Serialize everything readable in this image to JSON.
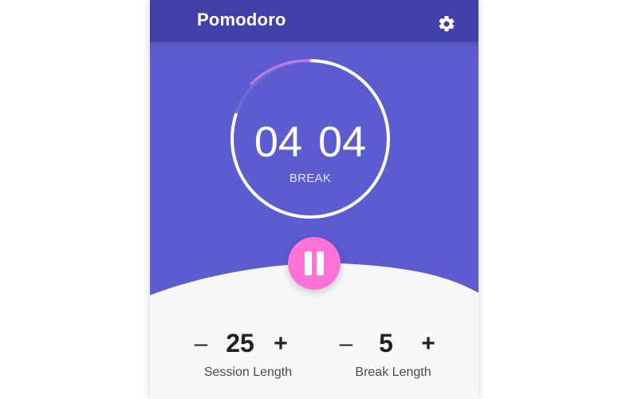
{
  "app": {
    "title": "Pomodoro"
  },
  "icons": {
    "settings": "gear-icon",
    "pause": "pause-icon"
  },
  "timer": {
    "minutes": "04",
    "seconds": "04",
    "mode": "BREAK",
    "ring_progress": 0.8
  },
  "controls": {
    "session": {
      "minus": "–",
      "value": "25",
      "plus": "+",
      "label": "Session Length"
    },
    "break": {
      "minus": "–",
      "value": "5",
      "plus": "+",
      "label": "Break Length"
    }
  },
  "colors": {
    "header": "#433fa8",
    "main": "#5c5bcf",
    "accent": "#ff73d6",
    "panel": "#f8f8f8"
  }
}
